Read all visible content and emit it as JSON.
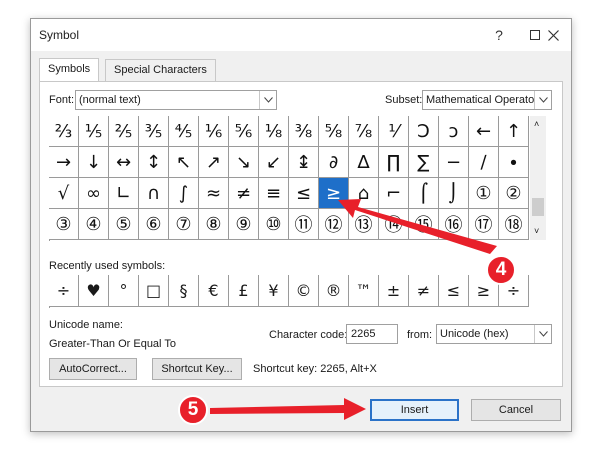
{
  "window": {
    "title": "Symbol"
  },
  "tabs": [
    {
      "label": "Symbols"
    },
    {
      "label": "Special Characters"
    }
  ],
  "font": {
    "label": "Font:",
    "value": "(normal text)"
  },
  "subset": {
    "label": "Subset:",
    "value": "Mathematical Operators"
  },
  "symbol_grid": [
    [
      "⅔",
      "⅕",
      "⅖",
      "⅗",
      "⅘",
      "⅙",
      "⅚",
      "⅛",
      "⅜",
      "⅝",
      "⅞",
      "⅟",
      "Ↄ",
      "ↄ",
      "←",
      "↑"
    ],
    [
      "→",
      "↓",
      "↔",
      "↕",
      "↖",
      "↗",
      "↘",
      "↙",
      "↨",
      "∂",
      "∆",
      "∏",
      "∑",
      "−",
      "∕",
      "∙"
    ],
    [
      "√",
      "∞",
      "∟",
      "∩",
      "∫",
      "≈",
      "≠",
      "≡",
      "≤",
      "≥",
      "⌂",
      "⌐",
      "⌠",
      "⌡",
      "①",
      "②"
    ],
    [
      "③",
      "④",
      "⑤",
      "⑥",
      "⑦",
      "⑧",
      "⑨",
      "⑩",
      "⑪",
      "⑫",
      "⑬",
      "⑭",
      "⑮",
      "⑯",
      "⑰",
      "⑱"
    ]
  ],
  "selected_symbol": "≥",
  "recent": {
    "label": "Recently used symbols:",
    "symbols": [
      "÷",
      "♥",
      "°",
      "□",
      "§",
      "€",
      "£",
      "¥",
      "©",
      "®",
      "™",
      "±",
      "≠",
      "≤",
      "≥",
      "÷"
    ]
  },
  "unicode_name": {
    "label": "Unicode name:",
    "value": "Greater-Than Or Equal To"
  },
  "character_code": {
    "label": "Character code:",
    "value": "2265"
  },
  "from": {
    "label": "from:",
    "value": "Unicode (hex)"
  },
  "buttons": {
    "autocorrect": "AutoCorrect...",
    "shortcut_key": "Shortcut Key...",
    "insert": "Insert",
    "cancel": "Cancel"
  },
  "shortcut_info": "Shortcut key: 2265, Alt+X",
  "annotations": {
    "step4": "4",
    "step5": "5",
    "color": "#e8202a"
  },
  "colors": {
    "selection": "#1e6fc9",
    "accent": "#2a72c8"
  }
}
